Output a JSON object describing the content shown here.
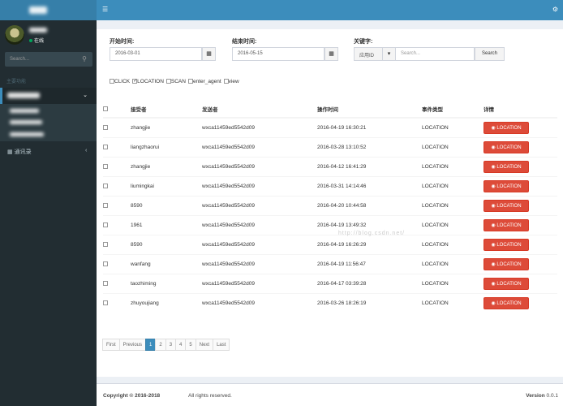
{
  "sidebar": {
    "status": "在线",
    "search_placeholder": "Search...",
    "nav_header": "主要功能",
    "nav_item2": "通讯录"
  },
  "filters": {
    "start_label": "开始时间:",
    "start_value": "2016-03-01",
    "end_label": "结束时间:",
    "end_value": "2016-05-15",
    "keyword_label": "关键字:",
    "keyword_type": "应用ID",
    "keyword_placeholder": "Search...",
    "search_button": "Search"
  },
  "checks": [
    {
      "label": "CLICK",
      "checked": false
    },
    {
      "label": "LOCATION",
      "checked": true
    },
    {
      "label": "SCAN",
      "checked": false
    },
    {
      "label": "enter_agent",
      "checked": false
    },
    {
      "label": "view",
      "checked": false
    }
  ],
  "table": {
    "headers": [
      "接受者",
      "发送者",
      "操作时间",
      "事件类型",
      "详情"
    ],
    "rows": [
      [
        "zhangjie",
        "wxca11459ed5542d09",
        "2016-04-19 16:30:21",
        "LOCATION",
        "LOCATION"
      ],
      [
        "liangzhaorui",
        "wxca11459ed5542d09",
        "2016-03-28 13:10:52",
        "LOCATION",
        "LOCATION"
      ],
      [
        "zhangjie",
        "wxca11459ed5542d09",
        "2016-04-12 16:41:29",
        "LOCATION",
        "LOCATION"
      ],
      [
        "liumingkai",
        "wxca11459ed5542d09",
        "2016-03-31 14:14:46",
        "LOCATION",
        "LOCATION"
      ],
      [
        "8590",
        "wxca11459ed5542d09",
        "2016-04-20 10:44:58",
        "LOCATION",
        "LOCATION"
      ],
      [
        "1961",
        "wxca11459ed5542d09",
        "2016-04-19 13:49:32",
        "LOCATION",
        "LOCATION"
      ],
      [
        "8590",
        "wxca11459ed5542d09",
        "2016-04-19 16:26:29",
        "LOCATION",
        "LOCATION"
      ],
      [
        "wanfang",
        "wxca11459ed5542d09",
        "2016-04-19 11:56:47",
        "LOCATION",
        "LOCATION"
      ],
      [
        "taozhiming",
        "wxca11459ed5542d09",
        "2016-04-17 03:39:28",
        "LOCATION",
        "LOCATION"
      ],
      [
        "zhuyoujiang",
        "wxca11459ed5542d09",
        "2016-03-26 18:26:19",
        "LOCATION",
        "LOCATION"
      ]
    ]
  },
  "pager": [
    "First",
    "Previous",
    "1",
    "2",
    "3",
    "4",
    "5",
    "Next",
    "Last"
  ],
  "pager_active": "1",
  "footer": {
    "copyright": "Copyright © 2016-2018",
    "rights": "All rights reserved.",
    "version_label": "Version",
    "version": "0.0.1"
  },
  "watermark": "http://blog.csdn.net/",
  "colors": {
    "topbar": "#3c8dbc",
    "sidebar": "#222d32",
    "location_button": "#dd4b39"
  }
}
